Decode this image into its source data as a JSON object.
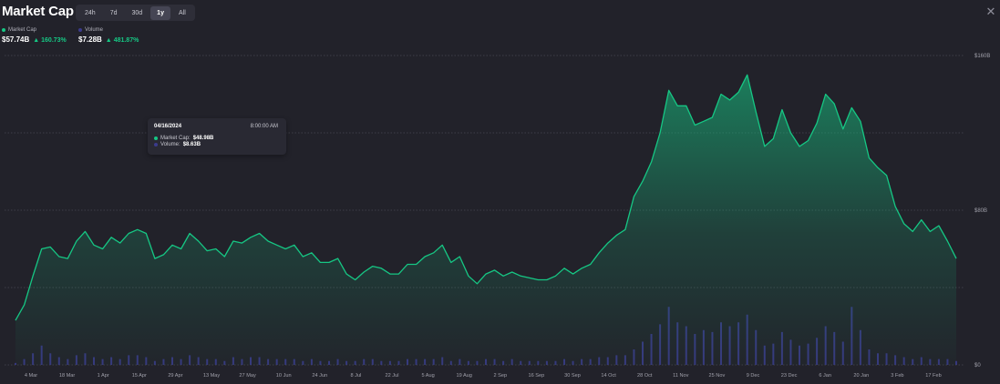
{
  "header": {
    "title": "Market Cap",
    "tabs": [
      {
        "label": "24h",
        "active": false
      },
      {
        "label": "7d",
        "active": false
      },
      {
        "label": "30d",
        "active": false
      },
      {
        "label": "1y",
        "active": true
      },
      {
        "label": "All",
        "active": false
      }
    ],
    "close_icon": "close-icon"
  },
  "legend": {
    "market_cap": {
      "name": "Market Cap",
      "value": "$57.74B",
      "change": "160.73%",
      "change_arrow": "▲",
      "color": "#16c784"
    },
    "volume": {
      "name": "Volume",
      "value": "$7.28B",
      "change": "481.87%",
      "change_arrow": "▲",
      "color": "#3b3b8c"
    }
  },
  "tooltip": {
    "date": "04/16/2024",
    "time": "8:00:00 AM",
    "market_cap_label": "Market Cap:",
    "market_cap_value": "$48.98B",
    "volume_label": "Volume:",
    "volume_value": "$8.63B"
  },
  "chart_data": {
    "type": "area",
    "y_ticks": [
      {
        "value": 0,
        "label": "$0"
      },
      {
        "value": 80,
        "label": "$80B"
      },
      {
        "value": 160,
        "label": "$160B"
      }
    ],
    "ylim": [
      0,
      160
    ],
    "grid": true,
    "x_ticks": [
      "4 Mar",
      "18 Mar",
      "1 Apr",
      "15 Apr",
      "29 Apr",
      "13 May",
      "27 May",
      "10 Jun",
      "24 Jun",
      "8 Jul",
      "22 Jul",
      "5 Aug",
      "19 Aug",
      "2 Sep",
      "16 Sep",
      "30 Sep",
      "14 Oct",
      "28 Oct",
      "11 Nov",
      "25 Nov",
      "9 Dec",
      "23 Dec",
      "6 Jan",
      "20 Jan",
      "3 Feb",
      "17 Feb"
    ],
    "series": [
      {
        "name": "Market Cap",
        "color": "#16c784",
        "unit": "B USD",
        "values": [
          23,
          31,
          46,
          60,
          61,
          56,
          55,
          64,
          69,
          62,
          60,
          66,
          63,
          68,
          70,
          68,
          55,
          57,
          62,
          60,
          68,
          64,
          59,
          60,
          56,
          64,
          63,
          66,
          68,
          64,
          62,
          60,
          62,
          56,
          58,
          53,
          53,
          55,
          47,
          44,
          48,
          51,
          50,
          47,
          47,
          52,
          52,
          56,
          58,
          62,
          53,
          56,
          46,
          42,
          47,
          49,
          46,
          48,
          46,
          45,
          44,
          44,
          46,
          50,
          47,
          50,
          52,
          58,
          63,
          67,
          70,
          87,
          95,
          105,
          120,
          142,
          134,
          134,
          124,
          126,
          128,
          140,
          137,
          141,
          150,
          131,
          113,
          117,
          132,
          120,
          113,
          116,
          125,
          140,
          135,
          122,
          133,
          126,
          107,
          102,
          98,
          82,
          73,
          69,
          75,
          69,
          72,
          64,
          55
        ]
      },
      {
        "name": "Volume",
        "color": "#3b3b8c",
        "unit": "B USD",
        "values": [
          1,
          3,
          6,
          10,
          6,
          4,
          3,
          5,
          6,
          4,
          3,
          4,
          3,
          5,
          5,
          4,
          2,
          3,
          4,
          3,
          5,
          4,
          3,
          3,
          2,
          4,
          3,
          4,
          4,
          3,
          3,
          3,
          3,
          2,
          3,
          2,
          2,
          3,
          2,
          2,
          3,
          3,
          2,
          2,
          2,
          3,
          3,
          3,
          3,
          4,
          2,
          3,
          2,
          2,
          3,
          3,
          2,
          3,
          2,
          2,
          2,
          2,
          2,
          3,
          2,
          3,
          3,
          4,
          4,
          5,
          5,
          8,
          12,
          16,
          21,
          30,
          22,
          20,
          16,
          18,
          17,
          22,
          20,
          22,
          26,
          18,
          10,
          11,
          17,
          13,
          10,
          11,
          14,
          20,
          17,
          12,
          30,
          18,
          8,
          6,
          6,
          5,
          4,
          3,
          4,
          3,
          3,
          3,
          2
        ]
      }
    ]
  }
}
